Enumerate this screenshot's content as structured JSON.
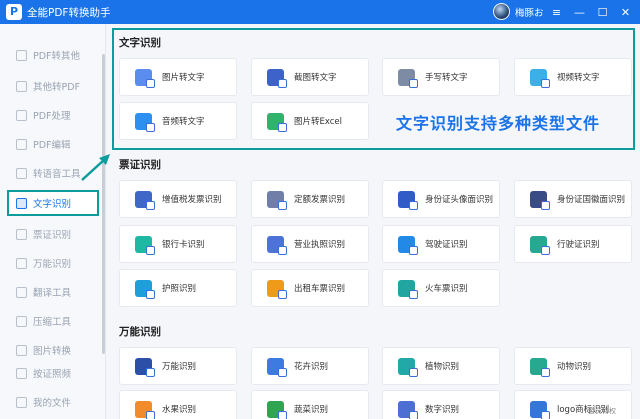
{
  "titlebar": {
    "logo_letter": "P",
    "title": "全能PDF转换助手",
    "user_name": "梅豚お",
    "ctrl_menu": "≡",
    "ctrl_min": "—",
    "ctrl_max": "☐",
    "ctrl_close": "✕"
  },
  "sidebar": {
    "items": [
      {
        "label": "PDF转其他"
      },
      {
        "label": "其他转PDF"
      },
      {
        "label": "PDF处理"
      },
      {
        "label": "PDF编辑"
      },
      {
        "label": "转语音工具"
      },
      {
        "label": "文字识别"
      },
      {
        "label": "票证识别"
      },
      {
        "label": "万能识别"
      },
      {
        "label": "翻译工具"
      },
      {
        "label": "压缩工具"
      },
      {
        "label": "图片转换"
      },
      {
        "label": "按证照频"
      },
      {
        "label": "我的文件"
      }
    ]
  },
  "sections": {
    "text_ocr": {
      "title": "文字识别",
      "cards": [
        {
          "label": "图片转文字",
          "color": "#5b8def"
        },
        {
          "label": "截图转文字",
          "color": "#3d62c9"
        },
        {
          "label": "手写转文字",
          "color": "#7d8ba5"
        },
        {
          "label": "视频转文字",
          "color": "#3cb0e6"
        },
        {
          "label": "音频转文字",
          "color": "#2d8ff0"
        },
        {
          "label": "图片转Excel",
          "color": "#30b36b"
        }
      ],
      "banner": "文字识别支持多种类型文件"
    },
    "ticket_ocr": {
      "title": "票证识别",
      "cards": [
        {
          "label": "增值税发票识别",
          "color": "#3e67c7"
        },
        {
          "label": "定额发票识别",
          "color": "#6f7fa8"
        },
        {
          "label": "身份证头像面识别",
          "color": "#2f5cc6"
        },
        {
          "label": "身份证国徽面识别",
          "color": "#3a4c86"
        },
        {
          "label": "银行卡识别",
          "color": "#1fb8a3"
        },
        {
          "label": "营业执照识别",
          "color": "#4e73d8"
        },
        {
          "label": "驾驶证识别",
          "color": "#2289e6"
        },
        {
          "label": "行驶证识别",
          "color": "#27a890"
        },
        {
          "label": "护照识别",
          "color": "#1f9fd9"
        },
        {
          "label": "出租车票识别",
          "color": "#f09a1a"
        },
        {
          "label": "火车票识别",
          "color": "#20a5a0"
        }
      ]
    },
    "universal_ocr": {
      "title": "万能识别",
      "cards": [
        {
          "label": "万能识别",
          "color": "#2c4fa8"
        },
        {
          "label": "花卉识别",
          "color": "#3d7be0"
        },
        {
          "label": "植物识别",
          "color": "#21a9a8"
        },
        {
          "label": "动物识别",
          "color": "#28a88f"
        },
        {
          "label": "水果识别",
          "color": "#f28b2c"
        },
        {
          "label": "蔬菜识别",
          "color": "#2fa552"
        },
        {
          "label": "数字识别",
          "color": "#4d6fd4"
        },
        {
          "label": "logo商标识别",
          "color": "#3577d8"
        }
      ]
    }
  },
  "watermark": "会员特权"
}
